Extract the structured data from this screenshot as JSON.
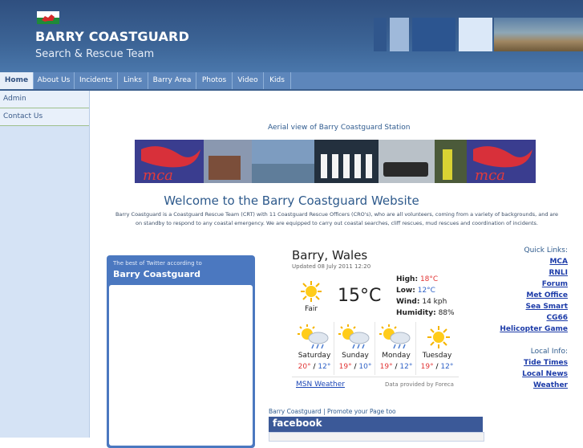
{
  "header": {
    "site_title": "BARRY COASTGUARD",
    "site_subtitle": "Search & Rescue Team"
  },
  "nav": {
    "tabs": [
      "Home",
      "About Us",
      "Incidents",
      "Links",
      "Barry Area",
      "Photos",
      "Video",
      "Kids"
    ],
    "active": "Home"
  },
  "sidebar": {
    "items": [
      "Admin",
      "Contact Us"
    ]
  },
  "main": {
    "photo_caption": "Aerial view of Barry Coastguard Station",
    "banner_logo_text": "mca",
    "welcome_title": "Welcome to the Barry Coastguard Website",
    "intro_line1": "Barry Coastguard is a Coastguard Rescue Team (CRT) with 11 Coastguard Rescue Officers (CRO's), who are all volunteers, coming from a variety of backgrounds, and are",
    "intro_line2": "on standby to respond to any coastal emergency. We are equipped to carry out coastal searches, cliff rescues, mud rescues and coordination of incidents."
  },
  "twitter": {
    "small_text": "The best of Twitter according to",
    "title": "Barry Coastguard"
  },
  "weather": {
    "city": "Barry, Wales",
    "updated": "Updated 08 July 2011 12:20",
    "temp": "15°C",
    "condition": "Fair",
    "high_label": "High:",
    "high": "18°C",
    "low_label": "Low:",
    "low": "12°C",
    "wind_label": "Wind:",
    "wind": "14 kph",
    "humidity_label": "Humidity:",
    "humidity": "88%",
    "forecast": [
      {
        "day": "Saturday",
        "high": "20°",
        "low": "12°"
      },
      {
        "day": "Sunday",
        "high": "19°",
        "low": "10°"
      },
      {
        "day": "Monday",
        "high": "19°",
        "low": "12°"
      },
      {
        "day": "Tuesday",
        "high": "19°",
        "low": "12°"
      }
    ],
    "temp_sep": "/",
    "source_link": "MSN Weather",
    "provider": "Data provided by Foreca"
  },
  "facebook": {
    "caption": "Barry Coastguard | Promote your Page too",
    "logo": "facebook"
  },
  "quick_links": {
    "heading": "Quick Links:",
    "items": [
      "MCA",
      "RNLI",
      "Forum",
      "Met Office",
      "Sea Smart",
      "CG66",
      "Helicopter Game"
    ]
  },
  "local_info": {
    "heading": "Local Info:",
    "items": [
      "Tide Times",
      "Local News",
      "Weather"
    ]
  },
  "colors": {
    "header": "#3c6496",
    "nav": "#5d86bb",
    "sidebar": "#d5e3f5",
    "accent_red": "#e13434",
    "accent_blue": "#2d60c6",
    "facebook": "#3b5998"
  }
}
